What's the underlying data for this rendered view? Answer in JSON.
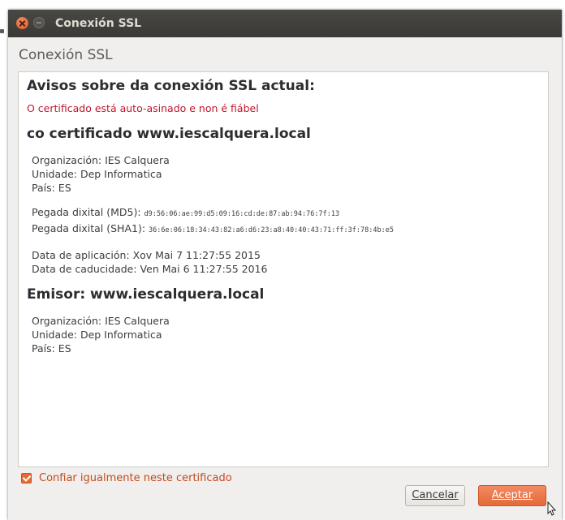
{
  "window": {
    "title": "Conexión SSL"
  },
  "dialog": {
    "heading": "Conexión SSL",
    "warnings_title": "Avisos sobre da conexión SSL actual:",
    "warning_text": "O certificado está auto-asinado e non é fiábel",
    "certificate_heading": "co certificado www.iescalquera.local",
    "certificate": {
      "organization": "Organización: IES Calquera",
      "unit": "Unidade: Dep Informatica",
      "country": "País: ES",
      "md5_label": "Pegada dixital (MD5):",
      "md5_value": "d9:56:06:ae:99:d5:09:16:cd:de:87:ab:94:76:7f:13",
      "sha1_label": "Pegada dixital (SHA1):",
      "sha1_value": "36:6e:06:18:34:43:82:a6:d6:23:a8:40:40:43:71:ff:3f:78:4b:e5",
      "issued": "Data de aplicación: Xov Mai 7 11:27:55 2015",
      "expires": "Data de caducidade: Ven Mai 6 11:27:55 2016"
    },
    "issuer_heading": "Emisor: www.iescalquera.local",
    "issuer": {
      "organization": "Organización: IES Calquera",
      "unit": "Unidade: Dep Informatica",
      "country": "País: ES"
    },
    "trust_checkbox_label": "Confiar igualmente neste certificado",
    "trust_checked": true,
    "cancel_label": "Cancelar",
    "accept_label": "Aceptar"
  },
  "colors": {
    "accent": "#e86a33",
    "warning": "#c0152d",
    "titlebar": "#3f3e3a"
  }
}
